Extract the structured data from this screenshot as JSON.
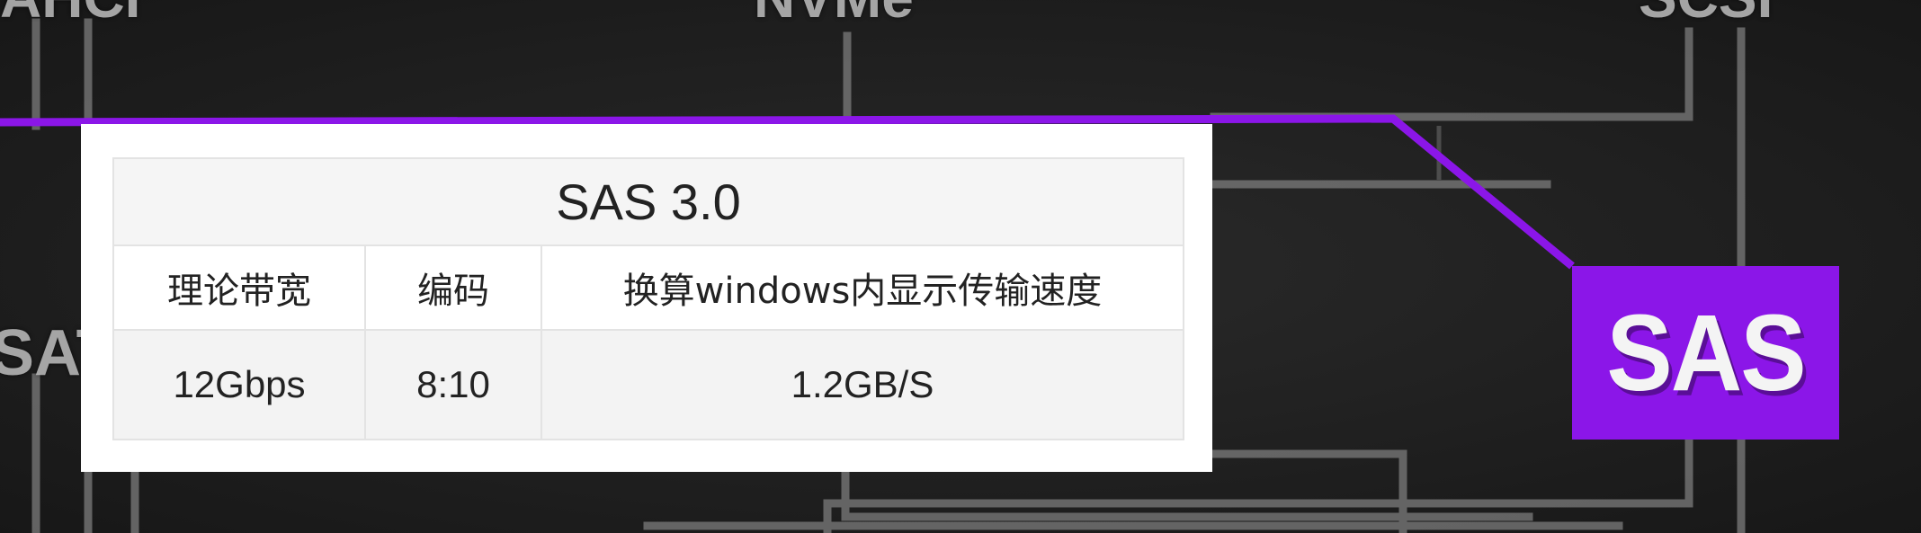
{
  "background": {
    "color": "#1f1f1f",
    "line_color": "#7a7a7a",
    "faded_labels": [
      "AHCI",
      "NVMe",
      "SCSI",
      "SAT"
    ]
  },
  "connector_color": "#8b16e8",
  "table": {
    "title": "SAS 3.0",
    "headers": [
      "理论带宽",
      "编码",
      "换算windows内显示传输速度"
    ],
    "row": [
      "12Gbps",
      "8:10",
      "1.2GB/S"
    ]
  },
  "label": {
    "text": "SAS",
    "bg_color": "#8b16e8"
  }
}
